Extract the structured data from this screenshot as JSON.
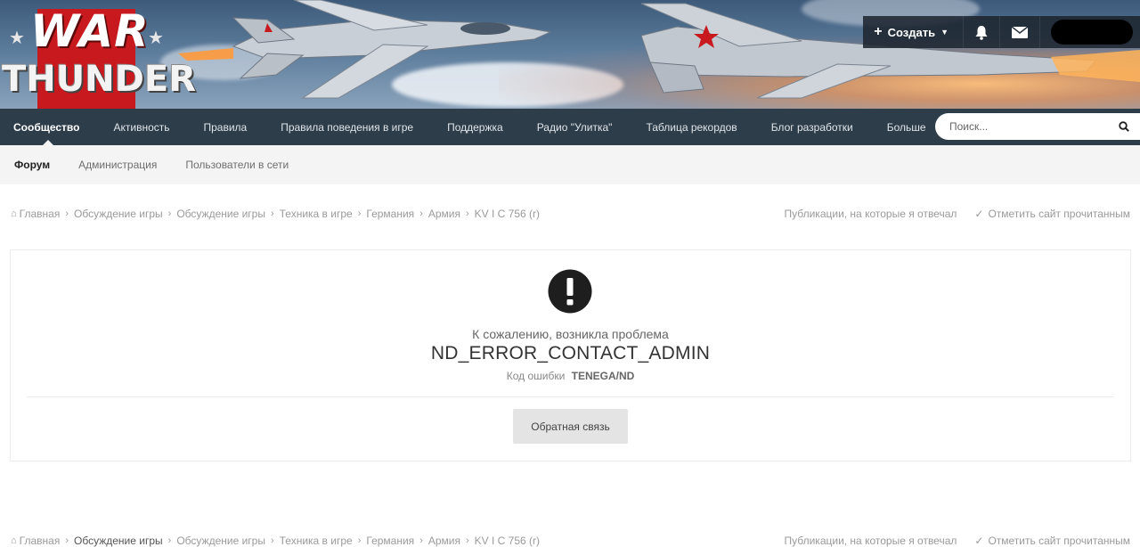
{
  "brand": {
    "line1": "WAR",
    "line2": "THUNDER"
  },
  "header": {
    "create_label": "Создать",
    "icons": [
      "plus-icon",
      "caret-down-icon",
      "bell-icon",
      "envelope-icon"
    ]
  },
  "nav": {
    "items": [
      {
        "label": "Сообщество"
      },
      {
        "label": "Активность"
      },
      {
        "label": "Правила"
      },
      {
        "label": "Правила поведения в игре"
      },
      {
        "label": "Поддержка"
      },
      {
        "label": "Радио \"Улитка\""
      },
      {
        "label": "Таблица рекордов"
      },
      {
        "label": "Блог разработки"
      },
      {
        "label": "Больше"
      }
    ],
    "search_placeholder": "Поиск..."
  },
  "subnav": {
    "items": [
      {
        "label": "Форум"
      },
      {
        "label": "Администрация"
      },
      {
        "label": "Пользователи в сети"
      }
    ]
  },
  "breadcrumb": {
    "items": [
      "Главная",
      "Обсуждение игры",
      "Обсуждение игры",
      "Техника в игре",
      "Германия",
      "Армия",
      "KV I C 756 (r)"
    ],
    "my_posts": "Публикации, на которые я отвечал",
    "mark_read": "Отметить сайт прочитанным"
  },
  "error": {
    "sorry": "К сожалению, возникла проблема",
    "message": "ND_ERROR_CONTACT_ADMIN",
    "code_label": "Код ошибки",
    "code_value": "TENEGA/ND",
    "feedback_label": "Обратная связь"
  },
  "colors": {
    "nav_bg": "#2e3d4a",
    "subnav_bg": "#f4f4f4",
    "logo_red": "#c8191e"
  }
}
